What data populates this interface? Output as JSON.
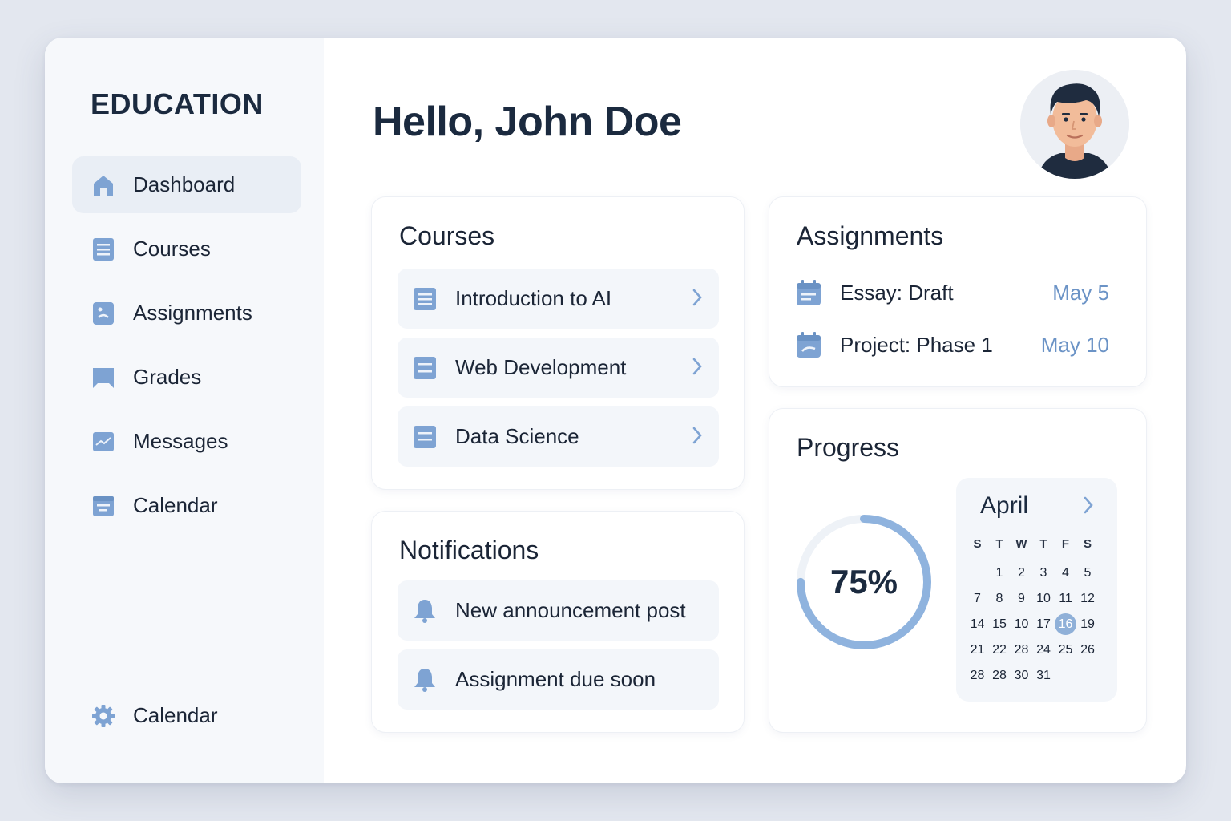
{
  "brand": "EDUCATION",
  "colors": {
    "accent": "#7ea3d3",
    "accent_text": "#6b93c6",
    "sidebar_bg": "#f6f8fb",
    "row_bg": "#f3f6fa"
  },
  "sidebar": {
    "items": [
      {
        "label": "Dashboard",
        "icon": "home-icon",
        "active": true
      },
      {
        "label": "Courses",
        "icon": "document-icon"
      },
      {
        "label": "Assignments",
        "icon": "clipboard-icon"
      },
      {
        "label": "Grades",
        "icon": "bookmark-icon"
      },
      {
        "label": "Messages",
        "icon": "chart-icon"
      },
      {
        "label": "Calendar",
        "icon": "calendar-icon"
      }
    ],
    "bottom_item": {
      "label": "Calendar",
      "icon": "gear-icon"
    }
  },
  "header": {
    "greeting": "Hello, John Doe",
    "avatar": "user-avatar"
  },
  "courses": {
    "title": "Courses",
    "items": [
      {
        "label": "Introduction to AI",
        "icon": "document-icon"
      },
      {
        "label": "Web Development",
        "icon": "document-icon"
      },
      {
        "label": "Data Science",
        "icon": "document-icon"
      }
    ]
  },
  "notifications": {
    "title": "Notifications",
    "items": [
      {
        "label": "New announcement post",
        "icon": "bell-icon"
      },
      {
        "label": "Assignment due soon",
        "icon": "bell-icon"
      }
    ]
  },
  "assignments": {
    "title": "Assignments",
    "items": [
      {
        "label": "Essay: Draft",
        "date": "May 5",
        "icon": "calendar-icon"
      },
      {
        "label": "Project: Phase 1",
        "date": "May 10",
        "icon": "calendar-icon"
      }
    ]
  },
  "progress": {
    "title": "Progress",
    "percent_label": "75%",
    "percent": 75,
    "calendar": {
      "month": "April",
      "weekdays": [
        "S",
        "T",
        "W",
        "T",
        "F",
        "S"
      ],
      "weeks": [
        [
          "",
          "1",
          "2",
          "3",
          "4",
          "5"
        ],
        [
          "7",
          "8",
          "9",
          "10",
          "11",
          "12"
        ],
        [
          "14",
          "15",
          "10",
          "17",
          "16",
          "19"
        ],
        [
          "21",
          "22",
          "28",
          "24",
          "25",
          "26"
        ],
        [
          "28",
          "28",
          "30",
          "31",
          "",
          ""
        ]
      ],
      "highlighted": "16"
    }
  }
}
